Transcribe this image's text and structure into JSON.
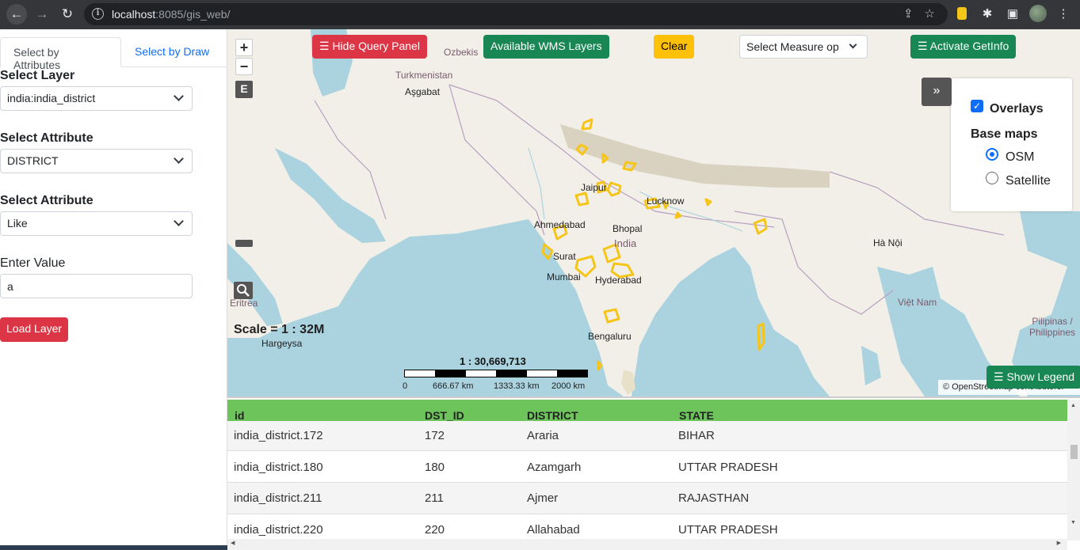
{
  "browser": {
    "url_host": "localhost",
    "url_rest": ":8085/gis_web/"
  },
  "panel": {
    "tabs": [
      "Select by Attributes",
      "Select by Draw"
    ],
    "select_layer_label": "Select Layer",
    "select_layer_value": "india:india_district",
    "select_attribute_label": "Select Attribute",
    "select_attribute_value": "DISTRICT",
    "select_operator_label": "Select Attribute",
    "select_operator_value": "Like",
    "enter_value_label": "Enter Value",
    "enter_value_value": "a",
    "load_button": "Load Layer"
  },
  "map": {
    "buttons": {
      "hide_query": "☰ Hide Query Panel",
      "wms_layers": "Available WMS Layers",
      "clear": "Clear",
      "measure": "Select Measure op",
      "getinfo": "☰ Activate GetInfo",
      "legend": "☰ Show Legend"
    },
    "zoom_in": "+",
    "zoom_out": "−",
    "extent": "E",
    "collapse": "»",
    "overlays_label": "Overlays",
    "basemaps_label": "Base maps",
    "basemap_osm": "OSM",
    "basemap_satellite": "Satellite",
    "scale_text": "Scale = 1 : 32M",
    "scalebar_ratio": "1 : 30,669,713",
    "scalebar_ticks": [
      "0",
      "666.67 km",
      "1333.33 km",
      "2000 km"
    ],
    "attribution": "© OpenStreetMap contributors.",
    "labels": {
      "turkmenistan": "Turkmenistan",
      "ashgabat": "Aşgabat",
      "ozbekis": "Ozbekis",
      "jaipur": "Jaipur",
      "lucknow": "Lucknow",
      "ahmedabad": "Ahmedabad",
      "bhopal": "Bhopal",
      "india": "India",
      "surat": "Surat",
      "mumbai": "Mumbai",
      "hyderabad": "Hyderabad",
      "bengaluru": "Bengaluru",
      "hargeysa": "Hargeysa",
      "eritrea": "Eritrea",
      "hanoi": "Hà Nội",
      "viet_nam": "Việt Nam",
      "pilipinas": "Pilipinas / Philippines"
    }
  },
  "table": {
    "headers": [
      "id",
      "DST_ID",
      "DISTRICT",
      "STATE"
    ],
    "rows": [
      [
        "india_district.172",
        "172",
        "Araria",
        "BIHAR"
      ],
      [
        "india_district.180",
        "180",
        "Azamgarh",
        "UTTAR PRADESH"
      ],
      [
        "india_district.211",
        "211",
        "Ajmer",
        "RAJASTHAN"
      ],
      [
        "india_district.220",
        "220",
        "Allahabad",
        "UTTAR PRADESH"
      ]
    ]
  },
  "colors": {
    "water": "#aad3df",
    "land": "#f2efe9",
    "highlight": "#f5c518",
    "table_header": "#6dc45a"
  }
}
